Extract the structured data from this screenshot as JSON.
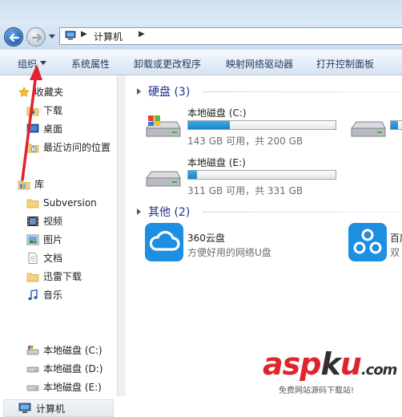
{
  "address": {
    "path": "计算机"
  },
  "toolbar": {
    "organize": "组织",
    "system_properties": "系统属性",
    "uninstall": "卸载或更改程序",
    "map_drive": "映射网络驱动器",
    "control_panel": "打开控制面板"
  },
  "nav": {
    "favorites": "收藏夹",
    "downloads": "下载",
    "desktop": "桌面",
    "recent": "最近访问的位置",
    "libraries": "库",
    "subversion": "Subversion",
    "videos": "视频",
    "pictures": "图片",
    "documents": "文档",
    "thunder": "迅雷下载",
    "music": "音乐",
    "computer": "计算机",
    "drive_c": "本地磁盘 (C:)",
    "drive_d": "本地磁盘 (D:)",
    "drive_e": "本地磁盘 (E:)"
  },
  "content": {
    "hard_disks_header": "硬盘 (3)",
    "other_header": "其他 (2)",
    "drives": [
      {
        "name": "本地磁盘 (C:)",
        "info": "143 GB 可用，共 200 GB",
        "used_fraction": 0.285
      },
      {
        "name": "本地磁盘 (E:)",
        "info": "311 GB 可用，共 331 GB",
        "used_fraction": 0.06
      }
    ],
    "drive_partial_used_fraction": 0.5,
    "other": [
      {
        "name": "360云盘",
        "desc": "方便好用的网络U盘"
      },
      {
        "name": "百度",
        "desc": "双"
      }
    ]
  },
  "watermark": {
    "brand_asp": "asp",
    "brand_k": "k",
    "brand_u": "u",
    "brand_tld": ".com",
    "sub": "免费网站源码下载站!"
  },
  "colors": {
    "accent": "#1e3287",
    "drive_fill": "#2a97d9",
    "annotation": "#e0242b"
  }
}
